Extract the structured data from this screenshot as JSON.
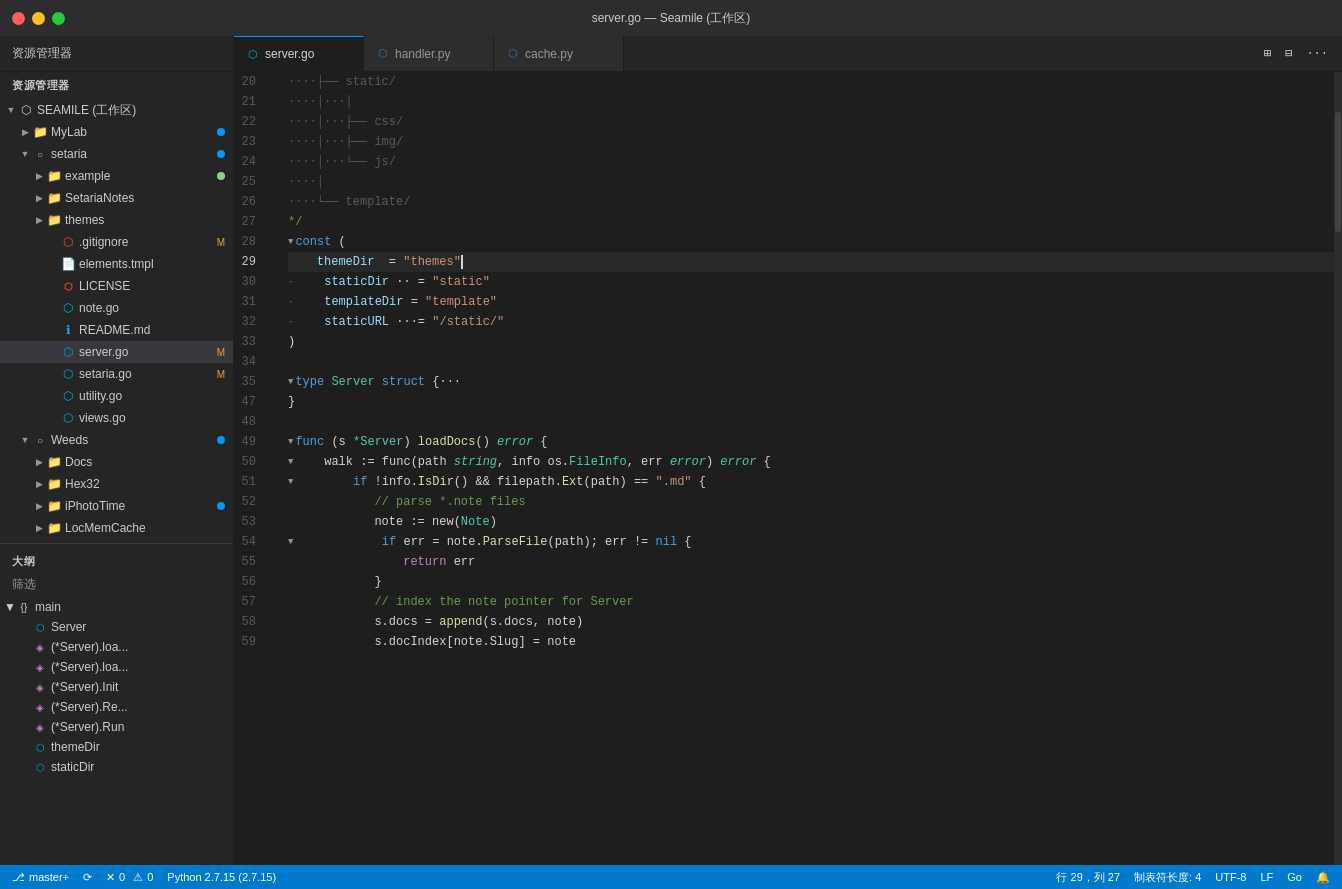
{
  "titleBar": {
    "title": "server.go — Seamile (工作区)",
    "closeBtn": "×",
    "minBtn": "–",
    "maxBtn": "+"
  },
  "tabBar": {
    "sidebarLabel": "资源管理器",
    "tabs": [
      {
        "id": "server-go",
        "icon": "⬡",
        "iconClass": "tab-icon-go",
        "label": "server.go",
        "active": true
      },
      {
        "id": "handler-py",
        "icon": "⬡",
        "iconClass": "tab-icon-py",
        "label": "handler.py",
        "active": false
      },
      {
        "id": "cache-py",
        "icon": "⬡",
        "iconClass": "tab-icon-py",
        "label": "cache.py",
        "active": false
      }
    ]
  },
  "sidebar": {
    "explorerLabel": "资源管理器",
    "tree": [
      {
        "level": 0,
        "arrow": "▼",
        "icon": "⬡",
        "iconColor": "#cccccc",
        "label": "SEAMILE (工作区)",
        "badge": ""
      },
      {
        "level": 1,
        "arrow": "▶",
        "icon": "📁",
        "iconColor": "#dcb67a",
        "label": "MyLab",
        "badge": "dot-blue"
      },
      {
        "level": 1,
        "arrow": "▼",
        "icon": "○",
        "iconColor": "#cccccc",
        "label": "setaria",
        "badge": "dot-blue"
      },
      {
        "level": 2,
        "arrow": "▶",
        "icon": "📁",
        "iconColor": "#dcb67a",
        "label": "example",
        "badge": "dot-green"
      },
      {
        "level": 2,
        "arrow": "▶",
        "icon": "📁",
        "iconColor": "#dcb67a",
        "label": "SetariaNotes",
        "badge": ""
      },
      {
        "level": 2,
        "arrow": "▶",
        "icon": "📁",
        "iconColor": "#dcb67a",
        "label": "themes",
        "badge": ""
      },
      {
        "level": 2,
        "arrow": "",
        "icon": "⬡",
        "iconColor": "#f05133",
        "label": ".gitignore",
        "badge": "M"
      },
      {
        "level": 2,
        "arrow": "",
        "icon": "📄",
        "iconColor": "#cccccc",
        "label": "elements.tmpl",
        "badge": ""
      },
      {
        "level": 2,
        "arrow": "",
        "icon": "⬡",
        "iconColor": "#e34c26",
        "label": "LICENSE",
        "badge": ""
      },
      {
        "level": 2,
        "arrow": "",
        "icon": "⬡",
        "iconColor": "#00add8",
        "label": "note.go",
        "badge": ""
      },
      {
        "level": 2,
        "arrow": "",
        "icon": "ℹ",
        "iconColor": "#3b9ddd",
        "label": "README.md",
        "badge": ""
      },
      {
        "level": 2,
        "arrow": "",
        "icon": "⬡",
        "iconColor": "#00add8",
        "label": "server.go",
        "badge": "M",
        "selected": true
      },
      {
        "level": 2,
        "arrow": "",
        "icon": "⬡",
        "iconColor": "#00add8",
        "label": "setaria.go",
        "badge": "M"
      },
      {
        "level": 2,
        "arrow": "",
        "icon": "⬡",
        "iconColor": "#00add8",
        "label": "utility.go",
        "badge": ""
      },
      {
        "level": 2,
        "arrow": "",
        "icon": "⬡",
        "iconColor": "#00add8",
        "label": "views.go",
        "badge": ""
      },
      {
        "level": 1,
        "arrow": "▼",
        "icon": "○",
        "iconColor": "#cccccc",
        "label": "Weeds",
        "badge": "dot-blue"
      },
      {
        "level": 2,
        "arrow": "▶",
        "icon": "📁",
        "iconColor": "#dcb67a",
        "label": "Docs",
        "badge": ""
      },
      {
        "level": 2,
        "arrow": "▶",
        "icon": "📁",
        "iconColor": "#dcb67a",
        "label": "Hex32",
        "badge": ""
      },
      {
        "level": 2,
        "arrow": "▶",
        "icon": "📁",
        "iconColor": "#dcb67a",
        "label": "iPhotoTime",
        "badge": "dot-blue"
      },
      {
        "level": 2,
        "arrow": "▶",
        "icon": "📁",
        "iconColor": "#dcb67a",
        "label": "LocMemCache",
        "badge": ""
      }
    ],
    "outlineLabel": "大纲",
    "filterLabel": "筛选",
    "outline": [
      {
        "level": 0,
        "arrow": "▼",
        "icon": "{}",
        "iconColor": "#cccccc",
        "label": "main"
      },
      {
        "level": 1,
        "arrow": "",
        "icon": "⬡",
        "iconColor": "#00add8",
        "label": "Server"
      },
      {
        "level": 1,
        "arrow": "",
        "icon": "◈",
        "iconColor": "#c586c0",
        "label": "(*Server).loa..."
      },
      {
        "level": 1,
        "arrow": "",
        "icon": "◈",
        "iconColor": "#c586c0",
        "label": "(*Server).loa..."
      },
      {
        "level": 1,
        "arrow": "",
        "icon": "◈",
        "iconColor": "#c586c0",
        "label": "(*Server).Init"
      },
      {
        "level": 1,
        "arrow": "",
        "icon": "◈",
        "iconColor": "#c586c0",
        "label": "(*Server).Re..."
      },
      {
        "level": 1,
        "arrow": "",
        "icon": "◈",
        "iconColor": "#c586c0",
        "label": "(*Server).Run"
      },
      {
        "level": 1,
        "arrow": "",
        "icon": "⬡",
        "iconColor": "#00add8",
        "label": "themeDir"
      },
      {
        "level": 1,
        "arrow": "",
        "icon": "⬡",
        "iconColor": "#00add8",
        "label": "staticDir"
      }
    ]
  },
  "editor": {
    "lines": [
      {
        "num": 20,
        "tokens": [
          {
            "text": "····├── static/",
            "class": "c-dim"
          }
        ]
      },
      {
        "num": 21,
        "tokens": [
          {
            "text": "····│···│",
            "class": "c-dim"
          }
        ]
      },
      {
        "num": 22,
        "tokens": [
          {
            "text": "····│···├── css/",
            "class": "c-dim"
          }
        ]
      },
      {
        "num": 23,
        "tokens": [
          {
            "text": "····│···├── img/",
            "class": "c-dim"
          }
        ]
      },
      {
        "num": 24,
        "tokens": [
          {
            "text": "····│···└── js/",
            "class": "c-dim"
          }
        ]
      },
      {
        "num": 25,
        "tokens": [
          {
            "text": "····│",
            "class": "c-dim"
          }
        ]
      },
      {
        "num": 26,
        "tokens": [
          {
            "text": "····└── template/",
            "class": "c-dim"
          }
        ]
      },
      {
        "num": 27,
        "tokens": [
          {
            "text": "*/",
            "class": "c-comment"
          }
        ]
      },
      {
        "num": 28,
        "fold": true,
        "tokens": [
          {
            "text": "const",
            "class": "c-keyword"
          },
          {
            "text": " (",
            "class": "c-light"
          }
        ]
      },
      {
        "num": 29,
        "active": true,
        "tokens": [
          {
            "text": "    themeDir",
            "class": "c-cyan"
          },
          {
            "text": "  = ",
            "class": "c-light"
          },
          {
            "text": "\"themes\"",
            "class": "c-string"
          },
          {
            "text": "CURSOR",
            "class": "cursor"
          }
        ]
      },
      {
        "num": 30,
        "tokens": [
          {
            "text": "·",
            "class": "c-dim"
          },
          {
            "text": "    staticDir",
            "class": "c-cyan"
          },
          {
            "text": "  = ",
            "class": "c-light"
          },
          {
            "text": "\"static\"",
            "class": "c-string"
          }
        ]
      },
      {
        "num": 31,
        "tokens": [
          {
            "text": "·",
            "class": "c-dim"
          },
          {
            "text": "    templateDir",
            "class": "c-cyan"
          },
          {
            "text": " = ",
            "class": "c-light"
          },
          {
            "text": "\"template\"",
            "class": "c-string"
          }
        ]
      },
      {
        "num": 32,
        "tokens": [
          {
            "text": "·",
            "class": "c-dim"
          },
          {
            "text": "    staticURL",
            "class": "c-cyan"
          },
          {
            "text": "   = ",
            "class": "c-light"
          },
          {
            "text": "\"/static/\"",
            "class": "c-string"
          }
        ]
      },
      {
        "num": 33,
        "tokens": [
          {
            "text": ")",
            "class": "c-light"
          }
        ]
      },
      {
        "num": 34,
        "tokens": []
      },
      {
        "num": 35,
        "fold": true,
        "tokens": [
          {
            "text": "type",
            "class": "c-keyword"
          },
          {
            "text": " Server ",
            "class": "c-teal"
          },
          {
            "text": "struct",
            "class": "c-keyword"
          },
          {
            "text": " {···",
            "class": "c-light"
          }
        ]
      },
      {
        "num": 47,
        "tokens": [
          {
            "text": "}",
            "class": "c-light"
          }
        ]
      },
      {
        "num": 48,
        "tokens": []
      },
      {
        "num": 49,
        "fold": true,
        "tokens": [
          {
            "text": "func",
            "class": "c-keyword"
          },
          {
            "text": " (s ",
            "class": "c-light"
          },
          {
            "text": "*Server",
            "class": "c-teal"
          },
          {
            "text": ") ",
            "class": "c-light"
          },
          {
            "text": "loadDocs",
            "class": "c-yellow-fn"
          },
          {
            "text": "() ",
            "class": "c-light"
          },
          {
            "text": "error",
            "class": "c-italic c-teal"
          },
          {
            "text": " {",
            "class": "c-light"
          }
        ]
      },
      {
        "num": 50,
        "fold": true,
        "tokens": [
          {
            "text": "    walk ",
            "class": "c-light"
          },
          {
            "text": ":=",
            "class": "c-light"
          },
          {
            "text": " func(path ",
            "class": "c-light"
          },
          {
            "text": "string",
            "class": "c-italic c-teal"
          },
          {
            "text": ", info os.",
            "class": "c-light"
          },
          {
            "text": "FileInfo",
            "class": "c-teal"
          },
          {
            "text": ", err ",
            "class": "c-light"
          },
          {
            "text": "error",
            "class": "c-italic c-teal"
          },
          {
            "text": ") ",
            "class": "c-light"
          },
          {
            "text": "error",
            "class": "c-italic c-teal"
          },
          {
            "text": " {",
            "class": "c-light"
          }
        ]
      },
      {
        "num": 51,
        "fold": true,
        "tokens": [
          {
            "text": "        if ",
            "class": "c-keyword-indent"
          },
          {
            "text": "!info.",
            "class": "c-light"
          },
          {
            "text": "IsDir",
            "class": "c-yellow-fn"
          },
          {
            "text": "() && filepath.",
            "class": "c-light"
          },
          {
            "text": "Ext",
            "class": "c-yellow-fn"
          },
          {
            "text": "(path) ",
            "class": "c-light"
          },
          {
            "text": "==",
            "class": "c-light"
          },
          {
            "text": " \".md\"",
            "class": "c-string"
          },
          {
            "text": " {",
            "class": "c-light"
          }
        ]
      },
      {
        "num": 52,
        "tokens": [
          {
            "text": "            // parse *.note files",
            "class": "c-comment"
          }
        ]
      },
      {
        "num": 53,
        "tokens": [
          {
            "text": "            note ",
            "class": "c-light"
          },
          {
            "text": ":=",
            "class": "c-light"
          },
          {
            "text": " new(",
            "class": "c-light"
          },
          {
            "text": "Note",
            "class": "c-teal"
          },
          {
            "text": ")",
            "class": "c-light"
          }
        ]
      },
      {
        "num": 54,
        "fold": true,
        "tokens": [
          {
            "text": "            if",
            "class": "c-keyword-indent"
          },
          {
            "text": " err = note.",
            "class": "c-light"
          },
          {
            "text": "ParseFile",
            "class": "c-yellow-fn"
          },
          {
            "text": "(path); err ",
            "class": "c-light"
          },
          {
            "text": "!=",
            "class": "c-light"
          },
          {
            "text": " nil",
            "class": "c-blue"
          },
          {
            "text": " {",
            "class": "c-light"
          }
        ]
      },
      {
        "num": 55,
        "tokens": [
          {
            "text": "                ",
            "class": "c-light"
          },
          {
            "text": "return",
            "class": "c-pink"
          },
          {
            "text": " err",
            "class": "c-light"
          }
        ]
      },
      {
        "num": 56,
        "tokens": [
          {
            "text": "            }",
            "class": "c-light"
          }
        ]
      },
      {
        "num": 57,
        "tokens": [
          {
            "text": "            // index the note pointer for Server",
            "class": "c-comment"
          }
        ]
      },
      {
        "num": 58,
        "tokens": [
          {
            "text": "            s.docs = ",
            "class": "c-light"
          },
          {
            "text": "append",
            "class": "c-yellow-fn"
          },
          {
            "text": "(s.docs, note)",
            "class": "c-light"
          }
        ]
      },
      {
        "num": 59,
        "tokens": [
          {
            "text": "            s.docIndex[note.Slug] = note",
            "class": "c-light"
          }
        ]
      }
    ]
  },
  "statusBar": {
    "branch": "master+",
    "sync": "⟳",
    "errors": "0",
    "warnings": "0",
    "python": "Python 2.7.15 (2.7.15)",
    "line": "行 29，列 27",
    "tabSize": "制表符长度: 4",
    "encoding": "UTF-8",
    "eol": "LF",
    "lang": "Go",
    "bell": "🔔"
  }
}
